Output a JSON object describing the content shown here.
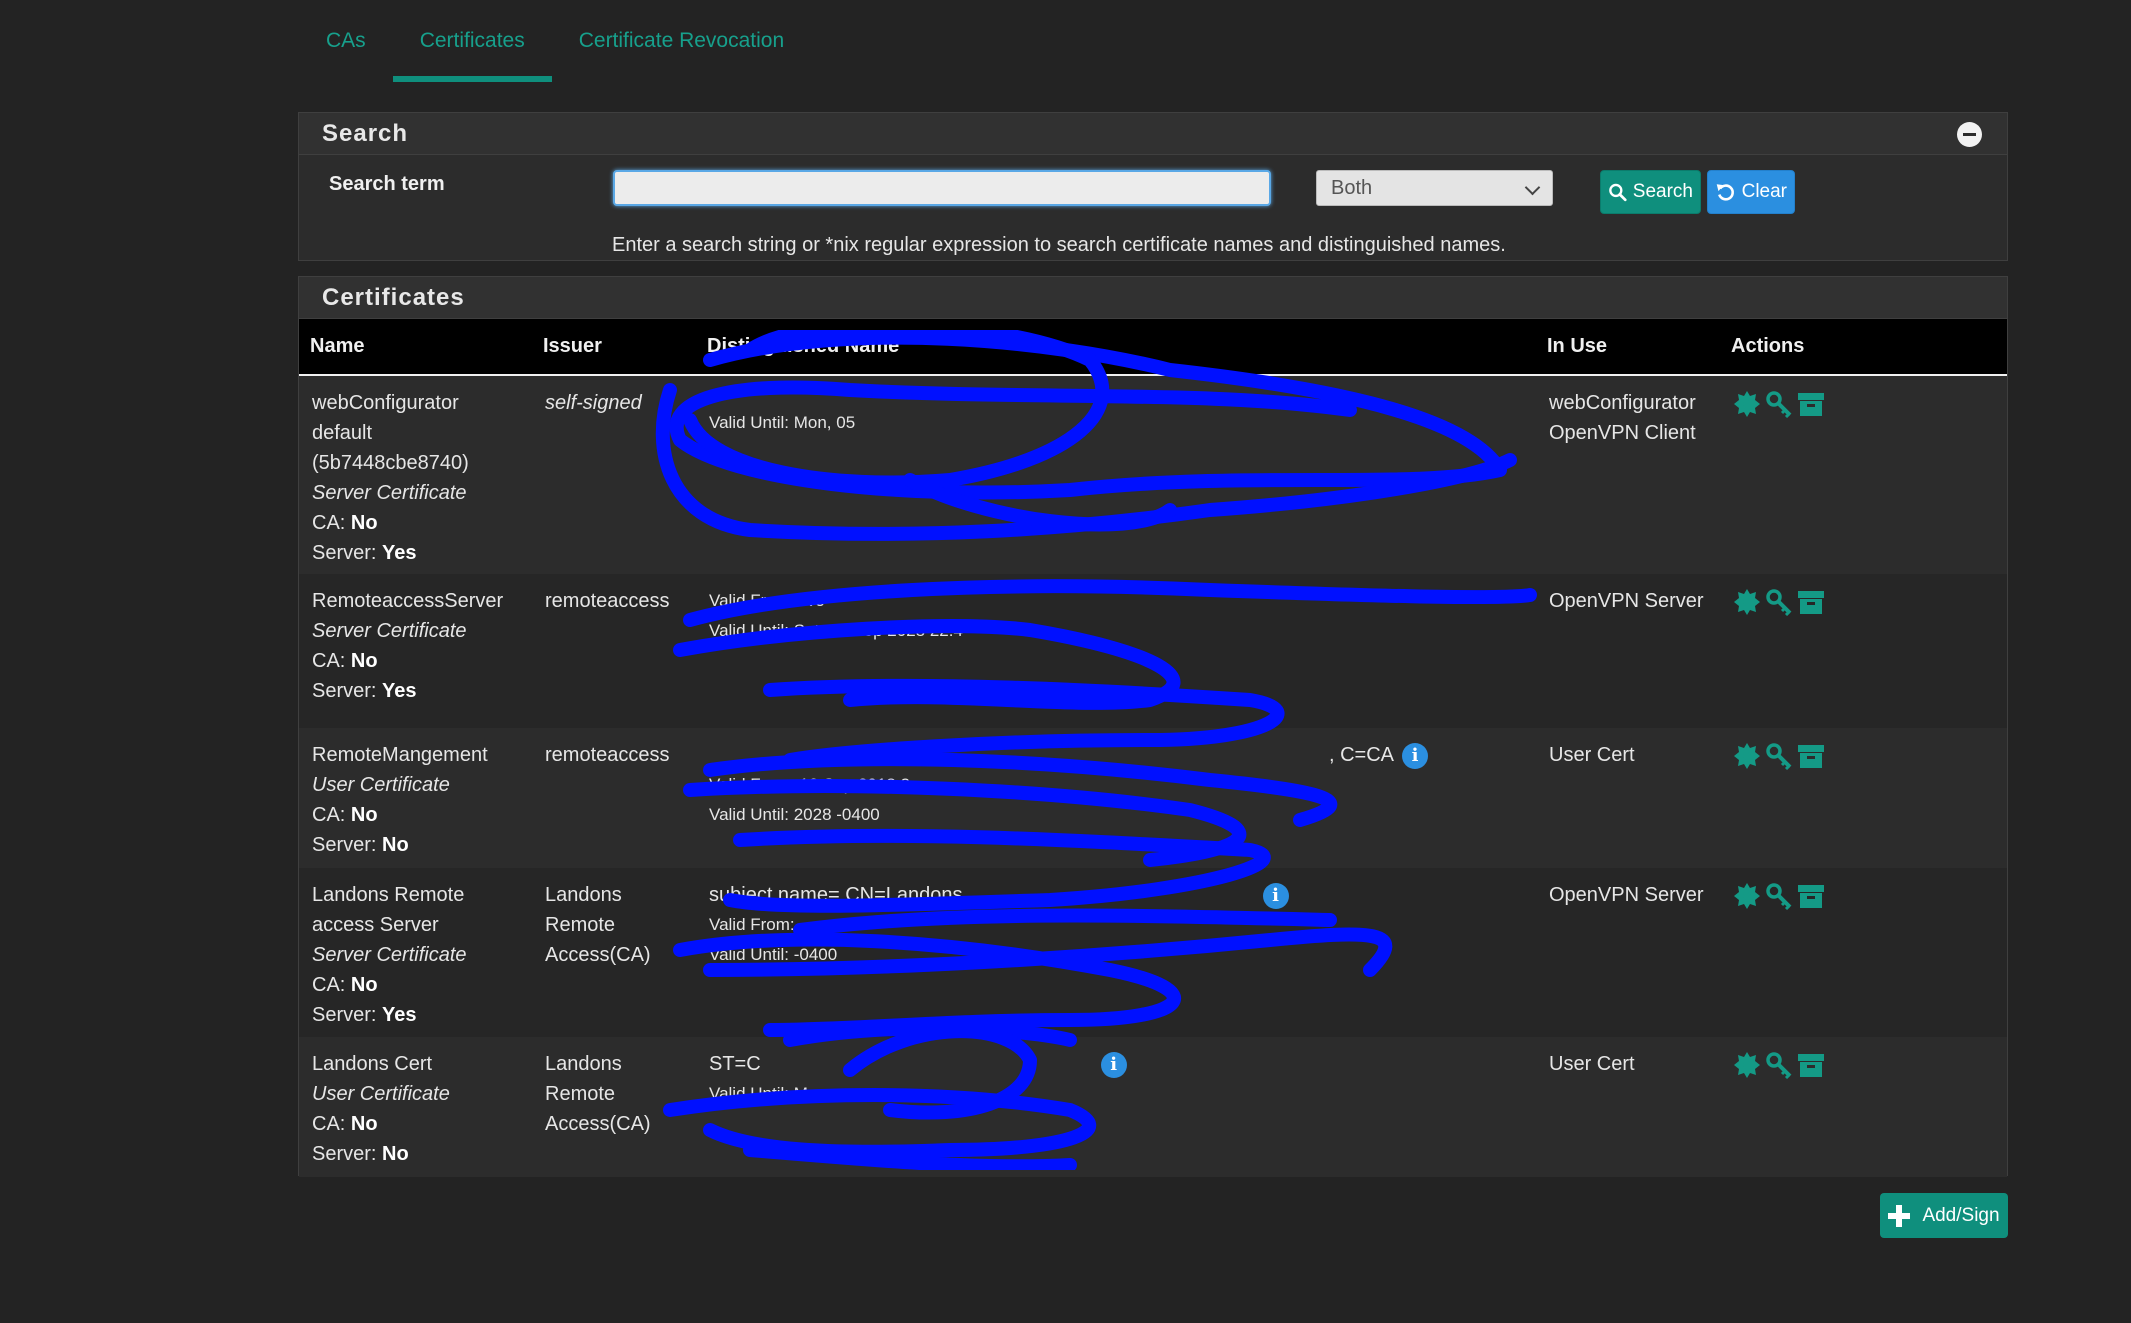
{
  "tabs": [
    {
      "label": "CAs",
      "active": false
    },
    {
      "label": "Certificates",
      "active": true
    },
    {
      "label": "Certificate Revocation",
      "active": false
    }
  ],
  "search": {
    "heading": "Search",
    "term_label": "Search term",
    "input_value": "",
    "scope_selected": "Both",
    "search_button": "Search",
    "clear_button": "Clear",
    "help_text": "Enter a search string or *nix regular expression to search certificate names and distinguished names."
  },
  "certificates": {
    "heading": "Certificates",
    "columns": [
      "Name",
      "Issuer",
      "Distinguished Name",
      "In Use",
      "Actions"
    ],
    "rows": [
      {
        "name_lines": [
          "webConfigurator",
          "default",
          "(5b7448cbe8740)"
        ],
        "type": "Server Certificate",
        "ca_label": "CA:",
        "ca": "No",
        "server_label": "Server:",
        "server": "Yes",
        "issuer": "self-signed",
        "dn_lines": [
          "",
          "",
          "Valid Until: Mon, 05"
        ],
        "in_use": [
          "webConfigurator",
          "OpenVPN Client"
        ]
      },
      {
        "name_lines": [
          "RemoteaccessServer"
        ],
        "type": "Server Certificate",
        "ca_label": "CA:",
        "ca": "No",
        "server_label": "Server:",
        "server": "Yes",
        "issuer": "remoteaccess",
        "dn_lines": [
          "",
          "",
          "Valid From: We",
          "Valid Until: Sat, 09 Sep 2028 22:4"
        ],
        "in_use": [
          "OpenVPN Server"
        ]
      },
      {
        "name_lines": [
          "RemoteMangement"
        ],
        "type": "User Certificate",
        "ca_label": "CA:",
        "ca": "No",
        "server_label": "Server:",
        "server": "No",
        "issuer": "remoteaccess",
        "dn_lines": [
          ", C=CA",
          "",
          "Valid From: 12 Sep 2018 2",
          "Valid Until: 2028 -0400"
        ],
        "in_use": [
          "User Cert"
        ]
      },
      {
        "name_lines": [
          "Landons Remote",
          "access Server"
        ],
        "type": "Server Certificate",
        "ca_label": "CA:",
        "ca": "No",
        "server_label": "Server:",
        "server": "Yes",
        "issuer_lines": [
          "Landons",
          "Remote",
          "Access(CA)"
        ],
        "dn_lines": [
          "subject name= CN=Landons",
          "Valid From:",
          "Valid Until: -0400"
        ],
        "in_use": [
          "OpenVPN Server"
        ]
      },
      {
        "name_lines": [
          "Landons Cert"
        ],
        "type": "User Certificate",
        "ca_label": "CA:",
        "ca": "No",
        "server_label": "Server:",
        "server": "No",
        "issuer_lines": [
          "Landons",
          "Remote",
          "Access(CA)"
        ],
        "dn_lines": [
          "ST=C",
          "",
          "",
          "Valid Until: Mon,"
        ],
        "in_use": [
          "User Cert"
        ]
      }
    ]
  },
  "add_button": "Add/Sign",
  "colors": {
    "accent": "#0f8f7d",
    "info": "#2b8fe0",
    "redaction": "#0010ff"
  }
}
